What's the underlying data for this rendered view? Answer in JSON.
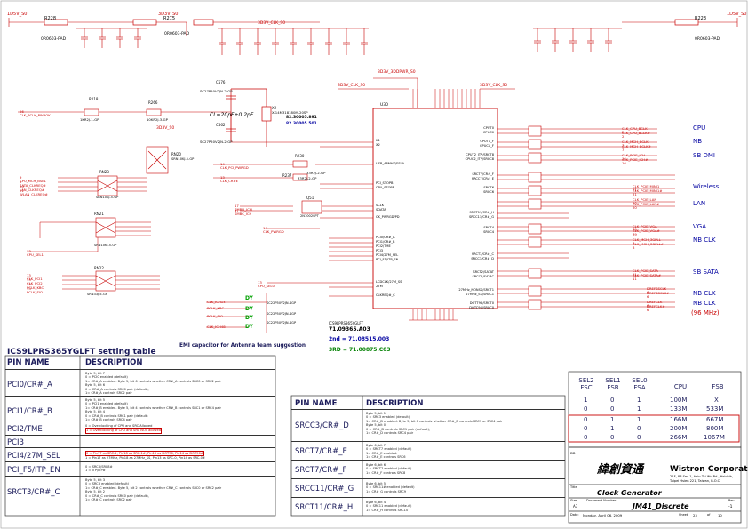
{
  "ic": {
    "refdes": "U30",
    "part": "ICS9LPRS365YGLFT",
    "part_no": "71.09365.A03",
    "second_source": "2nd = 71.08515.003",
    "third_source": "3RD = 71.00875.C03",
    "left_pins": [
      "X1",
      "X2",
      "USB_48MHZ/FSLA",
      "PCI_STOPB",
      "CPU_STOPB",
      "SCLK",
      "SDATA",
      "CK_PWRGD/PD",
      "PCI0/CR#_A",
      "PCI1/CR#_B",
      "PCI2/TME",
      "PCI3",
      "PCI4/27M_SEL",
      "PCI_F5/ITP_EN",
      "LCDCLK/27M_SS",
      "27M",
      "CLKREQ#_C"
    ],
    "right_pins": [
      "CPUT0",
      "CPUC0",
      "CPUT1_F",
      "CPUC1_F",
      "CPUT2_ITP/SRCT8",
      "CPUC2_ITP/SRCC8",
      "SRCT7/CR#_F",
      "SRCC7/CR#_E",
      "SRCT6",
      "SRCC6",
      "SRCT11/CR#_H",
      "SRCC11/CR#_G",
      "SRCT4",
      "SRCC4",
      "SRCT3/CR#_C",
      "SRCC3/CR#_D",
      "SRCT2/SATAT",
      "SRCC2/SATAC",
      "27MHz_NONSS/SRCT1",
      "27MHz_SS/SRCC1",
      "DOTT96/SRCT0",
      "DOTC96/SRCC0"
    ]
  },
  "crystal": {
    "refdes": "X2",
    "part": "X-14M318180M-20SP",
    "part_no1": "82.30005.891",
    "part_no2": "82.30005.501",
    "load_note": "CL=20pF±0.2pF",
    "caps": [
      "C576",
      "C562"
    ],
    "cap_value": "SC27P50V2JN-2-GP"
  },
  "power": {
    "labels": [
      "1D5V_S0",
      "3D3V_S0",
      "3D3V_CLK_S0",
      "1D5V_S0",
      "3D3V_3DDPWR_S0",
      "3D3V_CLK_S0",
      "3D3V_CLK_S0",
      "3D3V_S0"
    ],
    "resistors": [
      "R228",
      "R215",
      "R223"
    ],
    "res_values": [
      "0R0603-PAD",
      "0R0603-PAD",
      "0R0603-PAD"
    ]
  },
  "resistors": {
    "r_top": [
      "R218",
      "R266"
    ],
    "r_top_values": [
      "1KR2J-1-GP",
      "10KR2J-3-GP"
    ],
    "rn": [
      "RN20",
      "RN21",
      "RN22",
      "RN23",
      "RN24"
    ],
    "rn_value": "SRN10KJ-5-GP",
    "rn_value2": "SRN33J-5-GP",
    "r_mid": [
      "R230",
      "R237"
    ],
    "r_mid_values": [
      "33R2J-2-GP",
      "33R2J-2-GP"
    ],
    "q": "Q51",
    "q_value": "2N7002SPT"
  },
  "left_nets": [
    {
      "ref": "26",
      "net": "CLK_PCLK_PWROK"
    },
    {
      "ref": "9",
      "net": "CPU_MCH_BSEL"
    },
    {
      "ref": "9",
      "net": "SATA_CLKREQ#"
    },
    {
      "ref": "20",
      "net": "LAN_CLKREQ#"
    },
    {
      "ref": "21",
      "net": "WLAN_CLKREQ#"
    },
    {
      "ref": "14",
      "net": "CLK_PCI_PWRGD"
    },
    {
      "ref": "13",
      "net": "CLK_CR#E"
    },
    {
      "ref": "17",
      "net": "SMBD_ICH"
    },
    {
      "ref": "17",
      "net": "SMBC_ICH"
    },
    {
      "ref": "14",
      "net": "CLK_PWRGD"
    },
    {
      "ref": "13",
      "net": "CPU_SEL1"
    },
    {
      "ref": "13",
      "net": "CLK_PCI1"
    },
    {
      "ref": "13",
      "net": "CLK_PCI2"
    },
    {
      "ref": "13",
      "net": "PCLK_KBC"
    },
    {
      "ref": "13",
      "net": "PCLK_SIO"
    },
    {
      "ref": "13",
      "net": "CPU_SEL0"
    }
  ],
  "right_nets": [
    {
      "net": "CLK_CPU_BCLK",
      "ref": "2",
      "group": "CPU"
    },
    {
      "net": "CLK_CPU_BCLK#",
      "ref": "2",
      "group": ""
    },
    {
      "net": "CLK_MCH_BCLK",
      "ref": "7",
      "group": "NB"
    },
    {
      "net": "CLK_MCH_BCLK#",
      "ref": "7",
      "group": ""
    },
    {
      "net": "CLK_PCIE_ICH",
      "ref": "16",
      "group": "SB DMI"
    },
    {
      "net": "CLK_PCIE_ICH#",
      "ref": "16",
      "group": ""
    },
    {
      "net": "CLK_PCIE_MINI1",
      "ref": "21",
      "group": "Wireless"
    },
    {
      "net": "CLK_PCIE_MINI1#",
      "ref": "21",
      "group": ""
    },
    {
      "net": "CLK_PCIE_LAN",
      "ref": "20",
      "group": "LAN"
    },
    {
      "net": "CLK_PCIE_LAN#",
      "ref": "20",
      "group": ""
    },
    {
      "net": "CLK_PCIE_VGA",
      "ref": "39",
      "group": "VGA"
    },
    {
      "net": "CLK_PCIE_VGA#",
      "ref": "39",
      "group": ""
    },
    {
      "net": "CLK_MCH_3GPLL",
      "ref": "8",
      "group": "NB CLK"
    },
    {
      "net": "CLK_MCH_3GPLL#",
      "ref": "8",
      "group": ""
    },
    {
      "net": "CLK_PCIE_SATA",
      "ref": "11",
      "group": "SB SATA"
    },
    {
      "net": "CLK_PCIE_SATA#",
      "ref": "11",
      "group": ""
    },
    {
      "net": "DREFSSCLK",
      "ref": "6",
      "group": "NB CLK"
    },
    {
      "net": "DREFSSCLK#",
      "ref": "6",
      "group": ""
    },
    {
      "net": "DREFCLK",
      "ref": "6",
      "group": "NB CLK"
    },
    {
      "net": "DREFCLK#",
      "ref": "6",
      "group": "(96 MHz)"
    }
  ],
  "emi_caps": {
    "label": "DY",
    "part": "SC22P50V2JN-4GP",
    "nets": [
      "CLK_ICH14",
      "PCLK_KBC",
      "PCLK_SIO",
      "CLK_ICH48"
    ],
    "note": "EMI capacitor for Antenna team suggestion"
  },
  "setting_table": {
    "title": "ICS9LPRS365YGLFT setting table",
    "headers": [
      "PIN NAME",
      "DESCRIPTION"
    ],
    "rows": [
      {
        "pin": "PCI0/CR#_A",
        "desc": [
          "Byte 5, bit 7",
          "0 = PCI0 enabled (default)",
          "1= CR#_A enabled. Byte 5, bit 6 controls whether CR#_A controls SRC0 or SRC2 pair",
          "Byte 5, bit 6",
          "0 = CR#_A controls SRC0 pair (default),",
          "1= CR#_A controls SRC2 pair"
        ]
      },
      {
        "pin": "PCI1/CR#_B",
        "desc": [
          "Byte 5, bit 5",
          "0 = PCI1 enabled (default)",
          "1= CR#_B enabled. Byte 5, bit 4 controls whether CR#_B controls SRC1 or SRC4 pair",
          "Byte 5, bit 4",
          "0 = CR#_B controls SRC1 pair (default)",
          "1= CR#_B controls SRC4 pair"
        ]
      },
      {
        "pin": "PCI2/TME",
        "desc": [
          "0 = Overclocking of CPU and SRC Allowed",
          "1 = Overclocking of CPU and SRC NOT allowed"
        ]
      },
      {
        "pin": "PCI3",
        "desc": []
      },
      {
        "pin": "PCI4/27M_SEL",
        "desc": [
          "0 = Pin17 as SRC-1, Pin18 as SRC-1#, Pin13 as DOT96, Pin14 as DOT96#",
          "1 = Pin17 as 27MHz, Pin18 as 27MHz_SS, Pin13 as SRC-0, Pin14 as SRC-0#"
        ]
      },
      {
        "pin": "PCI_F5/ITP_EN",
        "desc": [
          "0 = SRC8/SRC8#",
          "1 = ITP/ITP#"
        ]
      },
      {
        "pin": "SRCT3/CR#_C",
        "desc": [
          "Byte 5, bit 3",
          "0 = SRC3 enabled (default)",
          "1= CR#_C enabled. Byte 5, bit 2 controls whether CR#_C controls SRC0 or SRC2 pair",
          "Byte 5, bit 2",
          "0 = CR#_C controls SRC0 pair (default),",
          "1= CR#_C controls SRC2 pair"
        ]
      }
    ],
    "rows2": [
      {
        "pin": "SRCC3/CR#_D",
        "desc": [
          "Byte 5, bit 1",
          "0 = SRC3 enabled (default)",
          "1= CR#_D enabled. Byte 5, bit 0 controls whether CR#_D controls SRC1 or SRC4 pair",
          "Byte 5, bit 0",
          "0 = CR#_D controls SRC1 pair (default),",
          "1= CR#_D controls SRC4 pair"
        ]
      },
      {
        "pin": "SRCT7/CR#_E",
        "desc": [
          "Byte 6, bit 7",
          "0 = SRCT7 enabled (default)",
          "1= CR#_E enabled.",
          "1= CR#_E controls SRC6"
        ]
      },
      {
        "pin": "SRCT7/CR#_F",
        "desc": [
          "Byte 6, bit 6",
          "0 = SRCT7 enabled (default)",
          "1= CR#_F controls SRC8"
        ]
      },
      {
        "pin": "SRCC11/CR#_G",
        "desc": [
          "Byte 6, bit 5",
          "0 = SRC11# enabled (default)",
          "1= CR#_G controls SRC9"
        ]
      },
      {
        "pin": "SRCT11/CR#_H",
        "desc": [
          "Byte 6, bit 4",
          "0 = SRC11 enabled (default)",
          "1= CR#_H controls SRC10"
        ]
      }
    ]
  },
  "freq_table": {
    "headers": [
      "SEL2 FSC",
      "SEL1 FSB",
      "SEL0 FSA",
      "CPU",
      "FSB"
    ],
    "rows": [
      [
        "1",
        "0",
        "1",
        "100M",
        "X"
      ],
      [
        "0",
        "0",
        "1",
        "133M",
        "533M"
      ],
      [
        "0",
        "1",
        "1",
        "166M",
        "667M"
      ],
      [
        "0",
        "1",
        "0",
        "200M",
        "800M"
      ],
      [
        "0",
        "0",
        "0",
        "266M",
        "1067M"
      ]
    ]
  },
  "title_block": {
    "company_cn": "緯創資通",
    "company": "Wistron Corporation",
    "address1": "21F, 88 Sec.1, Hsin Tai Wu Rd., Hsichih,",
    "address2": "Taipei Hsien 221, Taiwan, R.O.C.",
    "title_label": "Title",
    "title": "Clock Generator",
    "size_label": "Size",
    "size": "A3",
    "doc_label": "Document Number",
    "doc": "JM41_Discrete",
    "rev_label": "Rev",
    "rev": "-1",
    "date_label": "Date:",
    "date": "Monday, April 06, 2009",
    "sheet_label": "Sheet",
    "sheet": "23",
    "of_label": "of",
    "of": "10",
    "dbg": "DB"
  }
}
